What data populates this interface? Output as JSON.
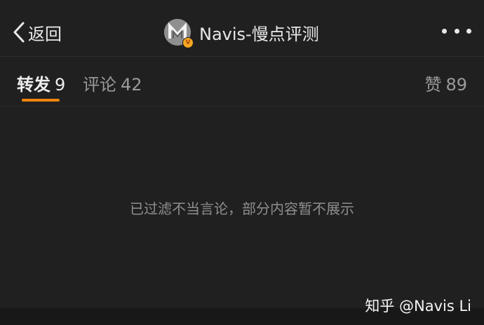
{
  "header": {
    "back_label": "返回",
    "title": "Navis-慢点评测",
    "avatar_logo": "M",
    "verified_badge": "V"
  },
  "tabs": {
    "repost": {
      "label": "转发",
      "count": "9"
    },
    "comment": {
      "label": "评论",
      "count": "42"
    },
    "like": {
      "label": "赞",
      "count": "89"
    },
    "active": "repost",
    "accent_color": "#f0860e"
  },
  "body": {
    "notice": "已过滤不当言论，部分内容暂不展示"
  },
  "watermark": "知乎 @Navis Li",
  "icons": {
    "back": "chevron-left-icon",
    "more": "more-dots-icon",
    "verified": "verified-badge-icon"
  }
}
